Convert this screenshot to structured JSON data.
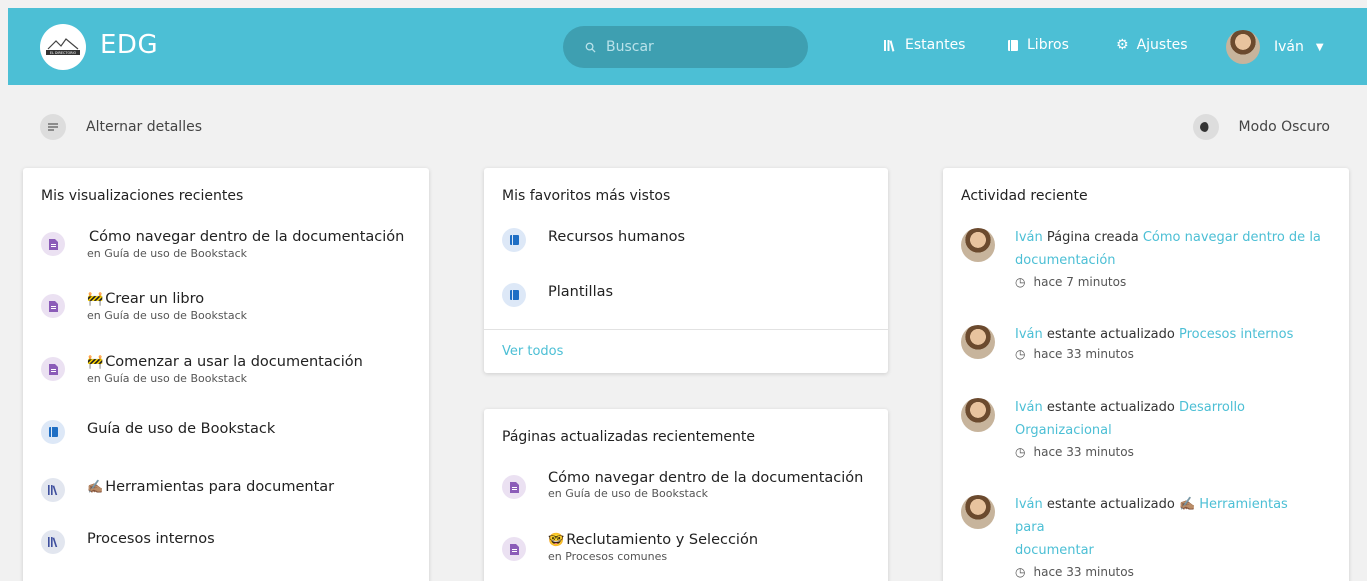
{
  "header": {
    "app_name": "EDG",
    "logo_text": "EL DIRECTORIO",
    "search_placeholder": "Buscar",
    "nav": {
      "shelves": "Estantes",
      "books": "Libros",
      "settings": "Ajustes",
      "user": "Iván"
    }
  },
  "toolbar": {
    "toggle_details": "Alternar detalles",
    "dark_mode": "Modo Oscuro"
  },
  "recent_views": {
    "title": "Mis visualizaciones recientes",
    "items": [
      {
        "type": "page",
        "emoji": "",
        "name": "Cómo navegar dentro de la documentación",
        "sub": "en Guía de uso de Bookstack"
      },
      {
        "type": "page",
        "emoji": "🚧",
        "name": "Crear un libro",
        "sub": "en Guía de uso de Bookstack"
      },
      {
        "type": "page",
        "emoji": "🚧",
        "name": "Comenzar a usar la documentación",
        "sub": "en Guía de uso de Bookstack"
      },
      {
        "type": "book",
        "emoji": "",
        "name": "Guía de uso de Bookstack",
        "sub": ""
      },
      {
        "type": "shelf",
        "emoji": "✍🏽",
        "name": "Herramientas para documentar",
        "sub": ""
      },
      {
        "type": "shelf",
        "emoji": "",
        "name": "Procesos internos",
        "sub": ""
      }
    ]
  },
  "favorites": {
    "title": "Mis favoritos más vistos",
    "items": [
      {
        "type": "book",
        "name": "Recursos humanos"
      },
      {
        "type": "book",
        "name": "Plantillas"
      }
    ],
    "see_all": "Ver todos"
  },
  "recent_pages": {
    "title": "Páginas actualizadas recientemente",
    "items": [
      {
        "type": "page",
        "emoji": "",
        "name": "Cómo navegar dentro de la documentación",
        "sub": "en Guía de uso de Bookstack"
      },
      {
        "type": "page",
        "emoji": "🤓",
        "name": "Reclutamiento y Selección",
        "sub": "en Procesos comunes"
      }
    ]
  },
  "activity": {
    "title": "Actividad reciente",
    "items": [
      {
        "user": "Iván",
        "action": "Página creada",
        "target_line1": "Cómo navegar dentro de la",
        "target_line2": "documentación",
        "time": "hace 7 minutos"
      },
      {
        "user": "Iván",
        "action": "estante actualizado",
        "target_line1": "Procesos internos",
        "target_line2": "",
        "time": "hace 33 minutos"
      },
      {
        "user": "Iván",
        "action": "estante actualizado",
        "target_line1": "Desarrollo",
        "target_line2": "Organizacional",
        "time": "hace 33 minutos"
      },
      {
        "user": "Iván",
        "action": "estante actualizado",
        "target_line1": "✍🏽 Herramientas para",
        "target_line2": "documentar",
        "time": "hace 33 minutos"
      }
    ]
  },
  "colors": {
    "header": "#4cbfd5",
    "link": "#4cbfd5",
    "page_icon": "#8b5cb8",
    "book_icon": "#1e6ec4",
    "shelf_icon": "#3e4f9e"
  }
}
